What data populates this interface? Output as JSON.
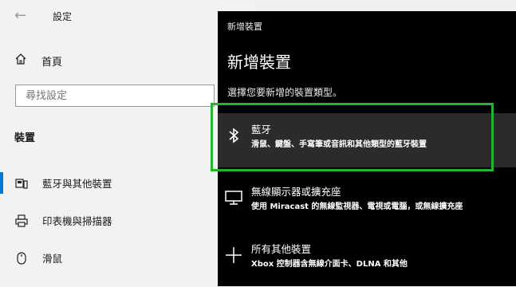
{
  "settings": {
    "title": "設定",
    "home_label": "首頁",
    "search_placeholder": "尋找設定",
    "section_title": "裝置",
    "nav": [
      {
        "label": "藍牙與其他裝置",
        "icon": "bluetooth-devices-icon",
        "active": true
      },
      {
        "label": "印表機與掃描器",
        "icon": "printer-icon",
        "active": false
      },
      {
        "label": "滑鼠",
        "icon": "mouse-icon",
        "active": false
      }
    ]
  },
  "dialog": {
    "caption": "新增裝置",
    "title": "新增裝置",
    "subtitle": "選擇您要新增的裝置類型。",
    "options": [
      {
        "name": "藍牙",
        "desc": "滑鼠、鍵盤、手寫筆或音訊和其他類型的藍牙裝置",
        "icon": "bluetooth-icon",
        "highlighted": true
      },
      {
        "name": "無線顯示器或擴充座",
        "desc": "使用 Miracast 的無線監視器、電視或電腦，或無線擴充座",
        "icon": "monitor-icon",
        "highlighted": false
      },
      {
        "name": "所有其他裝置",
        "desc": "Xbox 控制器含無線介面卡、DLNA 和其他",
        "icon": "plus-icon",
        "highlighted": false
      }
    ]
  },
  "colors": {
    "accent": "#0078d7",
    "highlight_border": "#21b531",
    "panel_bg": "#000000",
    "selected_option_bg": "#2b2b2b"
  }
}
